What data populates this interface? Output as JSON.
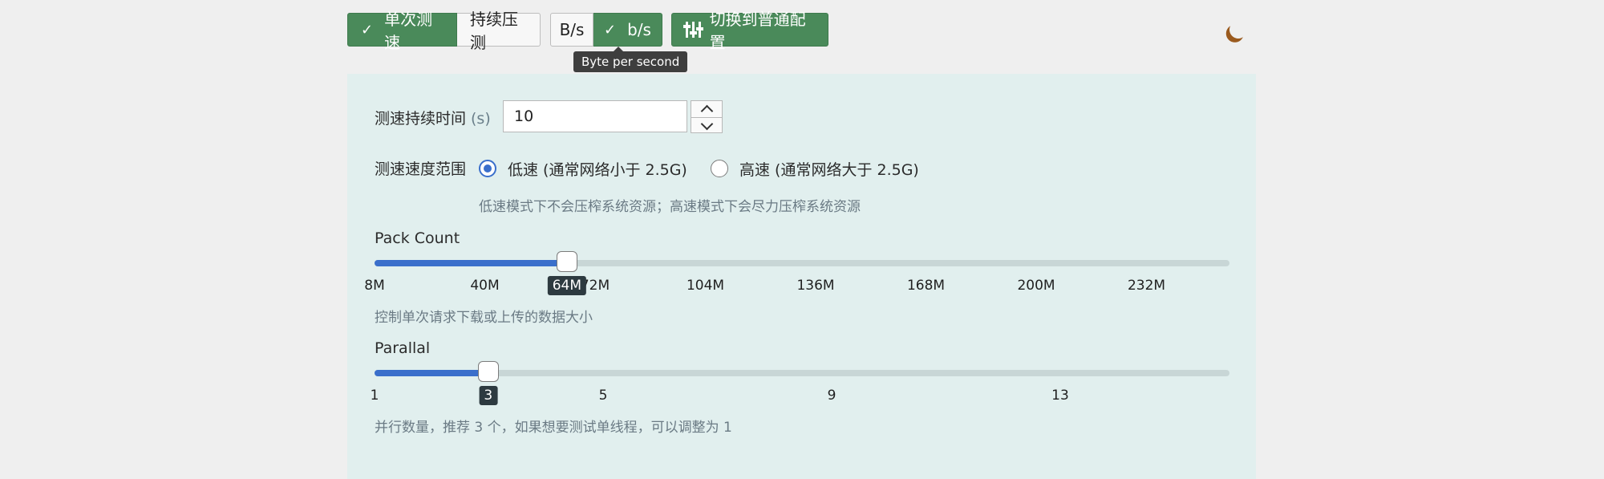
{
  "toolbar": {
    "test_mode": {
      "single": "单次测速",
      "continuous": "持续压测",
      "active": "single"
    },
    "unit": {
      "bytes": "B/s",
      "bits": "b/s",
      "active": "bits"
    },
    "switch_config": "切换到普通配置",
    "tooltip": "Byte per second"
  },
  "duration": {
    "label": "测速持续时间",
    "unit": "(s)",
    "value": "10"
  },
  "speed_range": {
    "label": "测速速度范围",
    "options": [
      "低速 (通常网络小于 2.5G)",
      "高速 (通常网络大于 2.5G)"
    ],
    "selected": 0,
    "hint": "低速模式下不会压榨系统资源；高速模式下会尽力压榨系统资源"
  },
  "pack_count": {
    "label": "Pack Count",
    "ticks": [
      "8M",
      "40M",
      "72M",
      "104M",
      "136M",
      "168M",
      "200M",
      "232M"
    ],
    "value": "64M",
    "fraction": 0.225,
    "hint": "控制单次请求下载或上传的数据大小"
  },
  "parallel": {
    "label": "Parallal",
    "ticks": [
      "1",
      "5",
      "9",
      "13"
    ],
    "value": "3",
    "fraction": 0.133,
    "hint": "并行数量，推荐 3 个，如果想要测试单线程，可以调整为 1"
  },
  "icons": {
    "check": "check-icon",
    "mixer": "sliders-icon",
    "theme": "moon-icon"
  },
  "colors": {
    "green": "#4a8a5a",
    "blue": "#3a6fcb",
    "panel": "#e1efee"
  }
}
